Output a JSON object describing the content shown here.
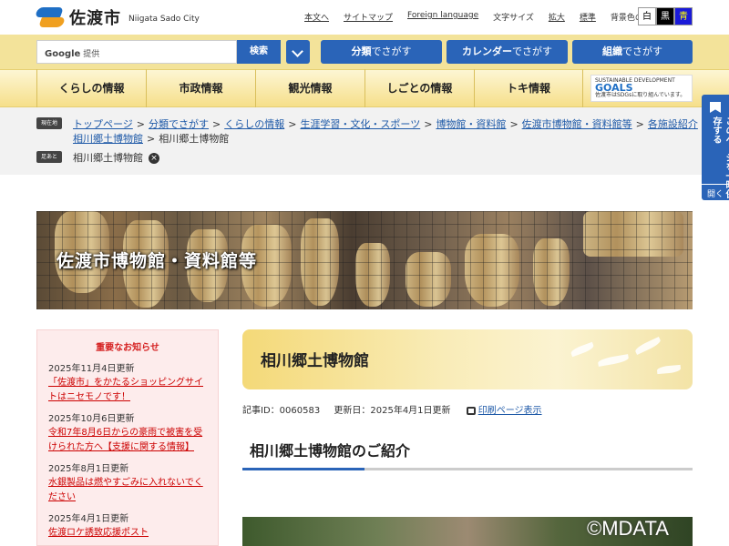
{
  "header": {
    "logo_text": "佐渡市",
    "logo_sub": "Niigata Sado City",
    "links": [
      "本文へ",
      "サイトマップ",
      "Foreign language"
    ],
    "font_size_label": "文字サイズ",
    "font_size_link": "拡大",
    "font_size_std": "標準",
    "bg_color_label": "背景色の変更",
    "bg_options": [
      "白",
      "黒",
      "青"
    ]
  },
  "search": {
    "provider": "Google",
    "provider_note": "提供",
    "button": "検索",
    "buttons": [
      {
        "strong": "分類",
        "rest": "でさがす"
      },
      {
        "strong": "カレンダー",
        "rest": "でさがす"
      },
      {
        "strong": "組織",
        "rest": "でさがす"
      }
    ]
  },
  "nav": {
    "items": [
      "くらしの情報",
      "市政情報",
      "観光情報",
      "しごとの情報",
      "トキ情報"
    ],
    "sdgs_title": "SUSTAINABLE DEVELOPMENT",
    "sdgs_goals": "GOALS",
    "sdgs_note": "佐渡市はSDGsに取り組んでいます。"
  },
  "breadcrumb": {
    "tag": "現在地",
    "items": [
      "トップページ",
      "分類でさがす",
      "くらしの情報",
      "生涯学習・文化・スポーツ",
      "博物館・資料館",
      "佐渡市博物館・資料館等",
      "各施設紹介"
    ],
    "line2_link": "相川郷土博物館",
    "current": "相川郷土博物館",
    "history_tag": "足あと",
    "history_item": "相川郷土博物館",
    "close_icon": "×"
  },
  "sidetab": {
    "label": "このページを一時保存する",
    "open": "開く"
  },
  "hero": {
    "title": "佐渡市博物館・資料館等"
  },
  "notice": {
    "title": "重要なお知らせ",
    "items": [
      {
        "date": "2025年11月4日更新",
        "text": "「佐渡市」をかたるショッピングサイトはニセモノです！"
      },
      {
        "date": "2025年10月6日更新",
        "text": "令和7年8月6日からの豪雨で被害を受けられた方へ【支援に関する情報】"
      },
      {
        "date": "2025年8月1日更新",
        "text": "水銀製品は燃やすごみに入れないでください"
      },
      {
        "date": "2025年4月1日更新",
        "text": "佐渡ロケ誘致応援ポスト"
      }
    ]
  },
  "main": {
    "title": "相川郷土博物館",
    "article_id": "記事ID：0060583",
    "updated": "更新日：2025年4月1日更新",
    "print": "印刷ページ表示",
    "section_title": "相川郷土博物館のご紹介"
  },
  "watermark": "©MDATA"
}
